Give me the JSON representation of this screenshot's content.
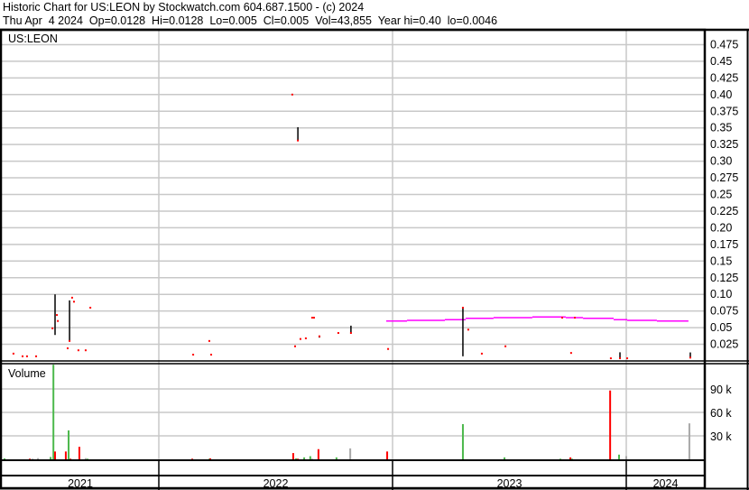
{
  "header": {
    "title": "Historic Chart for US:LEON by Stockwatch.com 604.687.1500 - (c) 2024",
    "quote": "Thu Apr  4 2024  Op=0.0128  Hi=0.0128  Lo=0.005  Cl=0.005  Vol=43,855  Year hi=0.40  lo=0.0046"
  },
  "colors": {
    "close": "#ff0000",
    "range": "#000000",
    "ma": "#ff00ff",
    "vol_up": "#4cb84c",
    "vol_down": "#ff0000",
    "vol_flat": "#a8a8a8",
    "grid": "#c8c8c8"
  },
  "chart_data": [
    {
      "type": "scatter",
      "title": "US:LEON",
      "ylabel": "",
      "xlim": [
        2021.33,
        2022.0,
        2024.34
      ],
      "ylim": [
        0,
        0.5
      ],
      "yticks": [
        "0.025",
        "0.05",
        "0.075",
        "0.10",
        "0.125",
        "0.15",
        "0.175",
        "0.20",
        "0.225",
        "0.25",
        "0.275",
        "0.30",
        "0.325",
        "0.35",
        "0.375",
        "0.40",
        "0.425",
        "0.45",
        "0.475"
      ],
      "xticks": [
        "2021",
        "2022",
        "2023",
        "2024"
      ],
      "grid": true,
      "closes": [
        {
          "t": 2021.378,
          "p": 0.011
        },
        {
          "t": 2021.417,
          "p": 0.007
        },
        {
          "t": 2021.436,
          "p": 0.007
        },
        {
          "t": 2021.475,
          "p": 0.007
        },
        {
          "t": 2021.545,
          "p": 0.049
        },
        {
          "t": 2021.564,
          "p": 0.069
        },
        {
          "t": 2021.568,
          "p": 0.06
        },
        {
          "t": 2021.61,
          "p": 0.019
        },
        {
          "t": 2021.618,
          "p": 0.03
        },
        {
          "t": 2021.629,
          "p": 0.095
        },
        {
          "t": 2021.637,
          "p": 0.089
        },
        {
          "t": 2021.656,
          "p": 0.016
        },
        {
          "t": 2021.687,
          "p": 0.016
        },
        {
          "t": 2021.707,
          "p": 0.08
        },
        {
          "t": 2022.147,
          "p": 0.0095
        },
        {
          "t": 2022.216,
          "p": 0.03
        },
        {
          "t": 2022.224,
          "p": 0.0095
        },
        {
          "t": 2022.571,
          "p": 0.4
        },
        {
          "t": 2022.595,
          "p": 0.331
        },
        {
          "t": 2022.583,
          "p": 0.022
        },
        {
          "t": 2022.606,
          "p": 0.033
        },
        {
          "t": 2022.629,
          "p": 0.034
        },
        {
          "t": 2022.656,
          "p": 0.065
        },
        {
          "t": 2022.664,
          "p": 0.065
        },
        {
          "t": 2022.687,
          "p": 0.037
        },
        {
          "t": 2022.768,
          "p": 0.042
        },
        {
          "t": 2022.822,
          "p": 0.042
        },
        {
          "t": 2022.981,
          "p": 0.018
        },
        {
          "t": 2023.301,
          "p": 0.08
        },
        {
          "t": 2023.324,
          "p": 0.047
        },
        {
          "t": 2023.382,
          "p": 0.011
        },
        {
          "t": 2023.483,
          "p": 0.022
        },
        {
          "t": 2023.726,
          "p": 0.065
        },
        {
          "t": 2023.78,
          "p": 0.065
        },
        {
          "t": 2023.764,
          "p": 0.012
        },
        {
          "t": 2023.934,
          "p": 0.004
        },
        {
          "t": 2023.973,
          "p": 0.004
        },
        {
          "t": 2024.004,
          "p": 0.004
        },
        {
          "t": 2024.274,
          "p": 0.005
        }
      ],
      "ranges": [
        {
          "t": 2021.556,
          "hi": 0.1,
          "lo": 0.039
        },
        {
          "t": 2021.618,
          "hi": 0.091,
          "lo": 0.03
        },
        {
          "t": 2022.595,
          "hi": 0.351,
          "lo": 0.331
        },
        {
          "t": 2022.687,
          "hi": 0.038,
          "lo": 0.035
        },
        {
          "t": 2022.822,
          "hi": 0.053,
          "lo": 0.042
        },
        {
          "t": 2023.301,
          "hi": 0.08,
          "lo": 0.007
        },
        {
          "t": 2023.973,
          "hi": 0.013,
          "lo": 0.004
        },
        {
          "t": 2024.274,
          "hi": 0.0128,
          "lo": 0.005
        }
      ],
      "moving_average": [
        {
          "t0": 2022.973,
          "t1": 2023.062,
          "p": 0.06
        },
        {
          "t0": 2023.062,
          "t1": 2023.224,
          "p": 0.061
        },
        {
          "t0": 2023.224,
          "t1": 2023.313,
          "p": 0.062
        },
        {
          "t0": 2023.313,
          "t1": 2023.432,
          "p": 0.064
        },
        {
          "t0": 2023.432,
          "t1": 2023.598,
          "p": 0.065
        },
        {
          "t0": 2023.598,
          "t1": 2023.741,
          "p": 0.066
        },
        {
          "t0": 2023.741,
          "t1": 2023.815,
          "p": 0.065
        },
        {
          "t0": 2023.815,
          "t1": 2023.946,
          "p": 0.064
        },
        {
          "t0": 2023.946,
          "t1": 2024.004,
          "p": 0.062
        },
        {
          "t0": 2024.004,
          "t1": 2024.131,
          "p": 0.061
        },
        {
          "t0": 2024.131,
          "t1": 2024.266,
          "p": 0.06
        }
      ]
    },
    {
      "type": "bar",
      "title": "Volume",
      "ylim": [
        0,
        120000
      ],
      "yticks": [
        "30 k",
        "60 k",
        "90 k"
      ],
      "bars": [
        {
          "t": 2021.34,
          "v": 1200,
          "c": "up"
        },
        {
          "t": 2021.448,
          "v": 800,
          "c": "down"
        },
        {
          "t": 2021.46,
          "v": 800,
          "c": "flat"
        },
        {
          "t": 2021.483,
          "v": 1500,
          "c": "flat"
        },
        {
          "t": 2021.537,
          "v": 3000,
          "c": "up"
        },
        {
          "t": 2021.549,
          "v": 121000,
          "c": "up"
        },
        {
          "t": 2021.556,
          "v": 10000,
          "c": "down"
        },
        {
          "t": 2021.602,
          "v": 10000,
          "c": "down"
        },
        {
          "t": 2021.614,
          "v": 37000,
          "c": "up"
        },
        {
          "t": 2021.622,
          "v": 800,
          "c": "down"
        },
        {
          "t": 2021.66,
          "v": 16000,
          "c": "down"
        },
        {
          "t": 2021.687,
          "v": 1500,
          "c": "flat"
        },
        {
          "t": 2021.695,
          "v": 800,
          "c": "up"
        },
        {
          "t": 2022.143,
          "v": 800,
          "c": "down"
        },
        {
          "t": 2022.216,
          "v": 800,
          "c": "up"
        },
        {
          "t": 2022.22,
          "v": 1200,
          "c": "down"
        },
        {
          "t": 2022.575,
          "v": 8000,
          "c": "down"
        },
        {
          "t": 2022.587,
          "v": 1200,
          "c": "up"
        },
        {
          "t": 2022.595,
          "v": 800,
          "c": "down"
        },
        {
          "t": 2022.622,
          "v": 2500,
          "c": "up"
        },
        {
          "t": 2022.648,
          "v": 4000,
          "c": "up"
        },
        {
          "t": 2022.656,
          "v": 800,
          "c": "flat"
        },
        {
          "t": 2022.683,
          "v": 13000,
          "c": "down"
        },
        {
          "t": 2022.76,
          "v": 2500,
          "c": "up"
        },
        {
          "t": 2022.819,
          "v": 14000,
          "c": "flat"
        },
        {
          "t": 2022.977,
          "v": 10000,
          "c": "down"
        },
        {
          "t": 2023.301,
          "v": 45000,
          "c": "up"
        },
        {
          "t": 2023.479,
          "v": 2500,
          "c": "up"
        },
        {
          "t": 2023.718,
          "v": 800,
          "c": "up"
        },
        {
          "t": 2023.761,
          "v": 2500,
          "c": "down"
        },
        {
          "t": 2023.768,
          "v": 800,
          "c": "up"
        },
        {
          "t": 2023.931,
          "v": 88000,
          "c": "down"
        },
        {
          "t": 2023.969,
          "v": 6000,
          "c": "up"
        },
        {
          "t": 2024.0,
          "v": 4000,
          "c": "flat"
        },
        {
          "t": 2024.27,
          "v": 46000,
          "c": "flat"
        }
      ]
    }
  ]
}
